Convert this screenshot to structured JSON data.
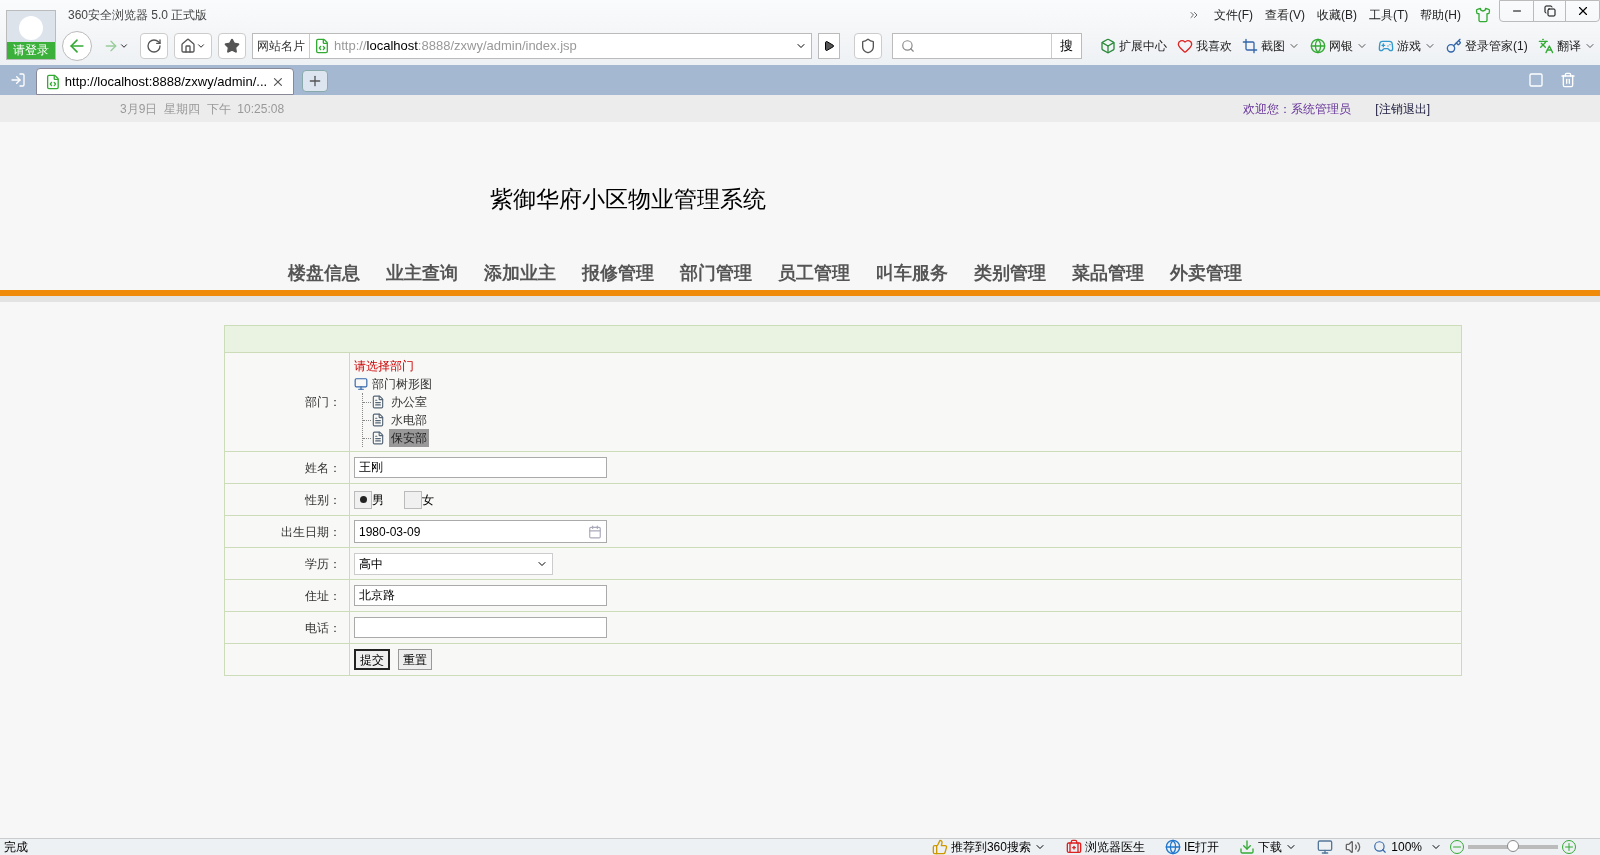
{
  "browser": {
    "title": "360安全浏览器 5.0 正式版",
    "login": "请登录",
    "menu": [
      "文件(F)",
      "查看(V)",
      "收藏(B)",
      "工具(T)",
      "帮助(H)"
    ],
    "site_label": "网站名片",
    "address": {
      "scheme": "http://",
      "host": "localhost",
      "rest": ":8888/zxwy/admin/index.jsp"
    },
    "search_button": "搜",
    "toolbar": [
      {
        "label": "扩展中心",
        "kind": "cube",
        "dropdown": false
      },
      {
        "label": "我喜欢",
        "kind": "heart",
        "dropdown": false
      },
      {
        "label": "截图",
        "kind": "crop",
        "dropdown": true
      },
      {
        "label": "网银",
        "kind": "globe",
        "dropdown": true
      },
      {
        "label": "游戏",
        "kind": "game",
        "dropdown": true
      },
      {
        "label": "登录管家(1)",
        "kind": "key",
        "dropdown": false
      },
      {
        "label": "翻译",
        "kind": "translate",
        "dropdown": true
      }
    ],
    "tabs": [
      {
        "title": "http://localhost:8888/zxwy/admin/...",
        "selected": true
      }
    ]
  },
  "page": {
    "date": "3月9日  星期四  下午  10:25:08",
    "welcome": "欢迎您：系统管理员",
    "logout": "[注销退出]",
    "title": "紫御华府小区物业管理系统",
    "nav": [
      "楼盘信息",
      "业主查询",
      "添加业主",
      "报修管理",
      "部门管理",
      "员工管理",
      "叫车服务",
      "类别管理",
      "菜品管理",
      "外卖管理"
    ],
    "form": [
      {
        "kind": "tree",
        "label": "部门：",
        "hint": "请选择部门",
        "root": "部门树形图",
        "children": [
          {
            "label": "办公室",
            "selected": false
          },
          {
            "label": "水电部",
            "selected": false
          },
          {
            "label": "保安部",
            "selected": true
          }
        ]
      },
      {
        "kind": "text",
        "label": "姓名：",
        "value": "王刚"
      },
      {
        "kind": "radio",
        "label": "性别：",
        "options": [
          {
            "label": "男",
            "selected": true
          },
          {
            "label": "女",
            "selected": false
          }
        ]
      },
      {
        "kind": "date",
        "label": "出生日期：",
        "value": "1980-03-09"
      },
      {
        "kind": "select",
        "label": "学历：",
        "value": "高中"
      },
      {
        "kind": "text",
        "label": "住址：",
        "value": "北京路"
      },
      {
        "kind": "text",
        "label": "电话："
      },
      {
        "kind": "buttons",
        "buttons": [
          {
            "label": "提交",
            "focused": true
          },
          {
            "label": "重置",
            "focused": false
          }
        ]
      }
    ]
  },
  "status_bar": {
    "status": "完成",
    "items": [
      {
        "label": "推荐到360搜索",
        "kind": "thumb",
        "dropdown": true
      },
      {
        "label": "浏览器医生",
        "kind": "doctor",
        "dropdown": false
      },
      {
        "label": "IE打开",
        "kind": "ie",
        "dropdown": false
      },
      {
        "label": "下载",
        "kind": "download",
        "dropdown": true
      }
    ],
    "zoom": "100%",
    "zoom_slider": {
      "level": 0.5
    }
  }
}
